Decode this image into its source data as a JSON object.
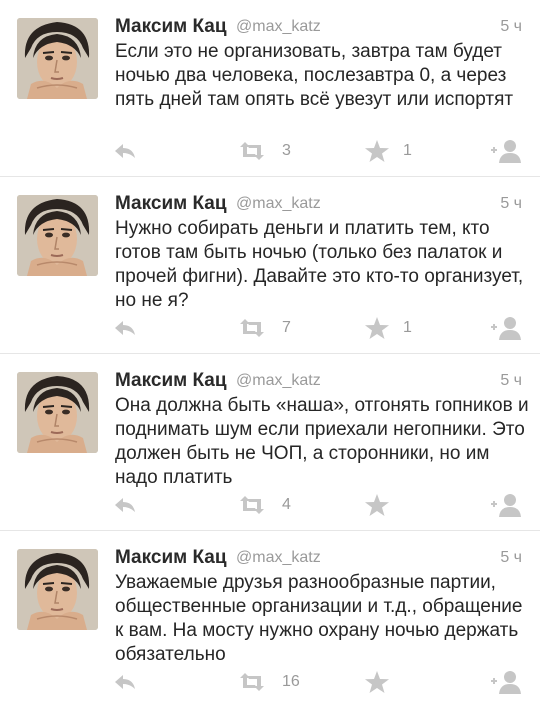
{
  "icons": {
    "reply": "reply-icon",
    "retweet": "retweet-icon",
    "favorite": "star-icon",
    "follow": "add-user-icon"
  },
  "colors": {
    "icon_gray": "#c6c6c6",
    "meta_gray": "#9a9a9a",
    "text": "#262626",
    "divider": "#e6e6e6"
  },
  "tweets": [
    {
      "author": "Максим Кац",
      "handle": "@max_katz",
      "time": "5 ч",
      "text": "Если это не организовать, завтра там будет ночью два человека, послезавтра 0, а через пять дней там опять всё увезут или испортят",
      "retweets": "3",
      "favorites": "1"
    },
    {
      "author": "Максим Кац",
      "handle": "@max_katz",
      "time": "5 ч",
      "text": "Нужно собирать деньги и платить тем, кто готов там быть ночью (только без палаток и прочей фигни). Давайте это кто-то организует, но не я?",
      "retweets": "7",
      "favorites": "1"
    },
    {
      "author": "Максим Кац",
      "handle": "@max_katz",
      "time": "5 ч",
      "text": "Она должна быть «наша», отгонять гопников и поднимать шум если приехали негопники. Это должен быть не ЧОП, а сторонники, но им надо платить",
      "retweets": "4",
      "favorites": ""
    },
    {
      "author": "Максим Кац",
      "handle": "@max_katz",
      "time": "5 ч",
      "text": "Уважаемые друзья разнообразные партии, общественные организации и т.д., обращение к вам. На мосту нужно охрану ночью держать обязательно",
      "retweets": "16",
      "favorites": ""
    }
  ]
}
